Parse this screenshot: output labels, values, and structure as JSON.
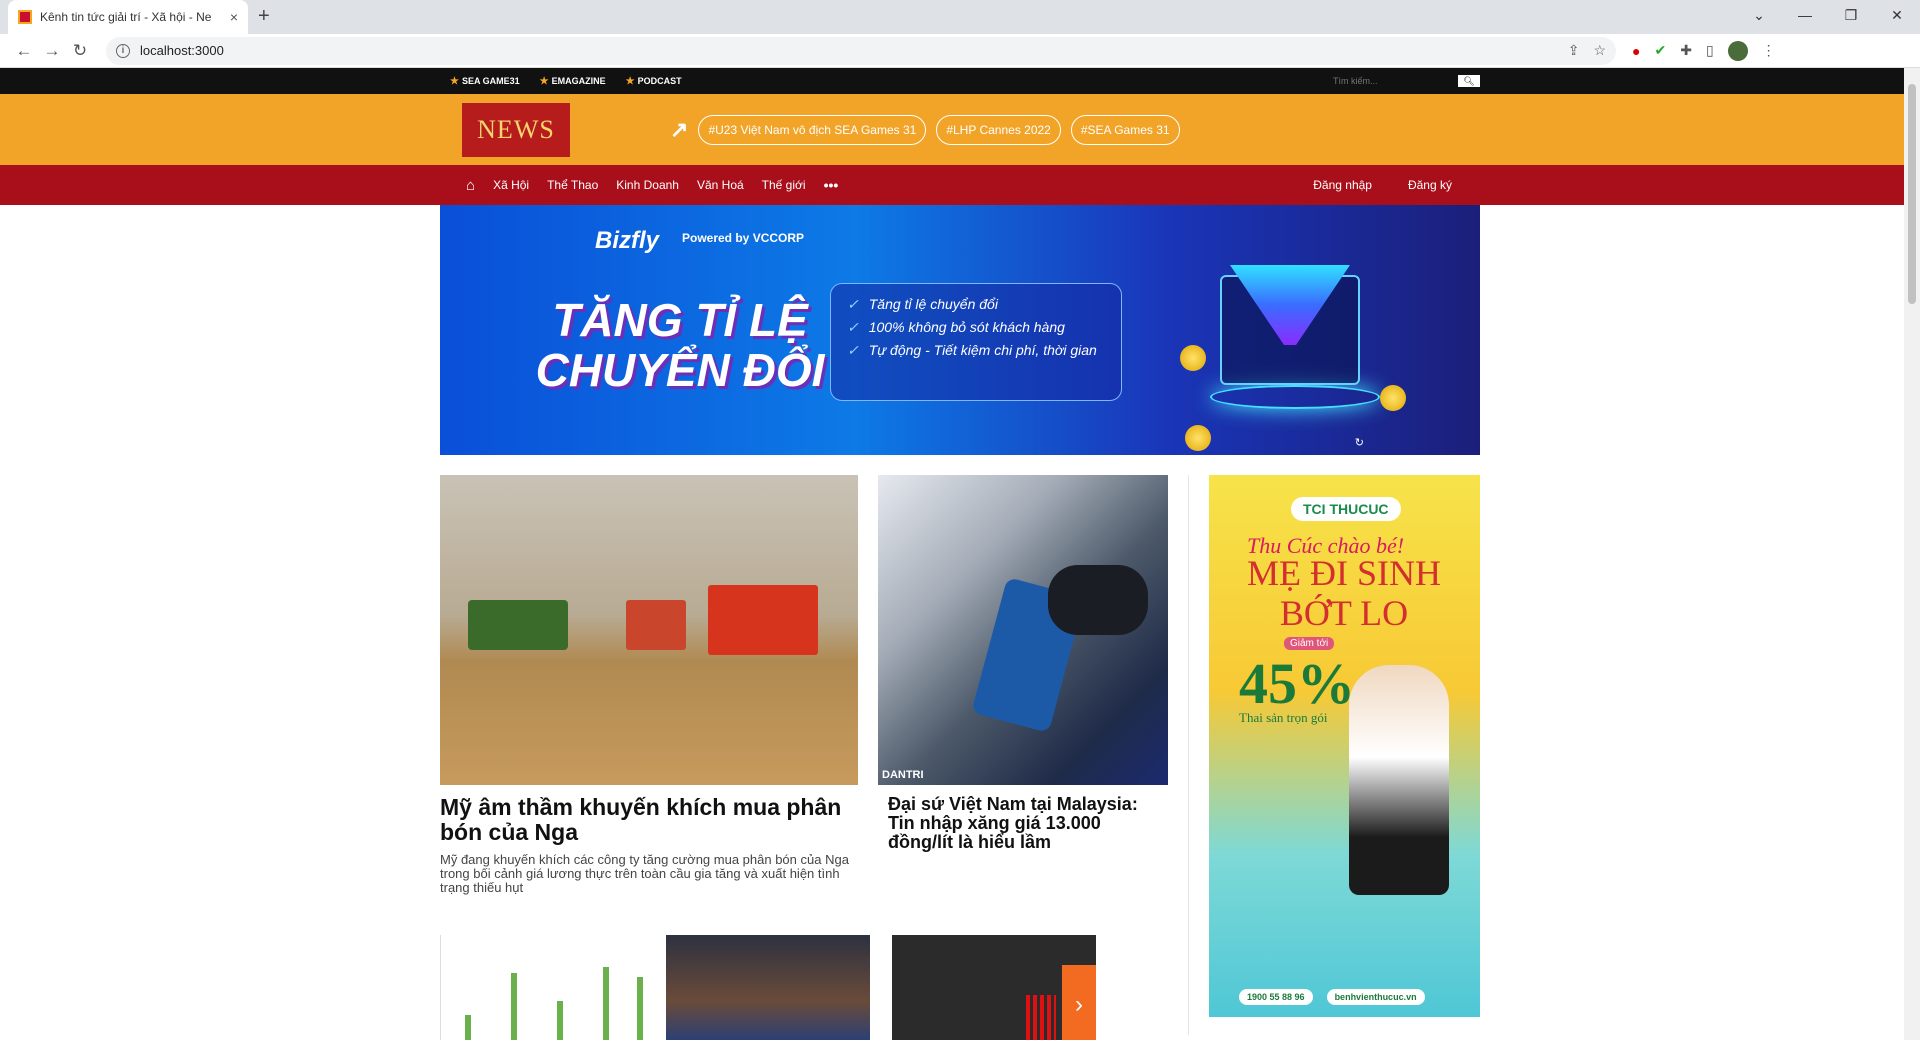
{
  "browser": {
    "tab_title": "Kênh tin tức giải trí - Xã hội - Ne",
    "url": "localhost:3000",
    "new_tab": "+",
    "close": "×"
  },
  "topbar": {
    "links": [
      "SEA GAME31",
      "EMAGAZINE",
      "PODCAST"
    ],
    "search_placeholder": "Tìm kiếm..."
  },
  "header": {
    "logo": "NEWS",
    "trending_tags": [
      "#U23 Việt Nam vô địch SEA Games 31",
      "#LHP Cannes 2022",
      "#SEA Games 31"
    ]
  },
  "nav": {
    "items": [
      "Xã Hội",
      "Thể Thao",
      "Kinh Doanh",
      "Văn Hoá",
      "Thế giới"
    ],
    "login": "Đăng nhập",
    "register": "Đăng ký"
  },
  "banner": {
    "brand": "Bizfly",
    "partner": "Powered by VCCORP",
    "title": "TĂNG TỈ LỆ CHUYỂN ĐỔI",
    "features": [
      "Tăng tỉ lệ chuyển đổi",
      "100% không bỏ sót khách hàng",
      "Tự động - Tiết kiệm chi phí, thời gian"
    ]
  },
  "stories": {
    "lead": {
      "title": "Mỹ âm thầm khuyến khích mua phân bón của Nga",
      "summary": "Mỹ đang khuyến khích các công ty tăng cường mua phân bón của Nga trong bối cảnh giá lương thực trên toàn cầu gia tăng và xuất hiện tình trạng thiếu hụt"
    },
    "second": {
      "title": "Đại sứ Việt Nam tại Malaysia: Tin nhập xăng giá 13.000 đồng/lít là hiểu lầm",
      "watermark": "DANTRI"
    }
  },
  "ad": {
    "logo": "TCI THUCUC",
    "line1": "Thu Cúc chào bé!",
    "line2": "MẸ ĐI SINH BỚT LO",
    "badge": "Giảm tới",
    "percent": "45%",
    "sub": "Thai sản trọn gói",
    "phone": "1900 55 88 96",
    "website": "benhvienthucuc.vn"
  }
}
